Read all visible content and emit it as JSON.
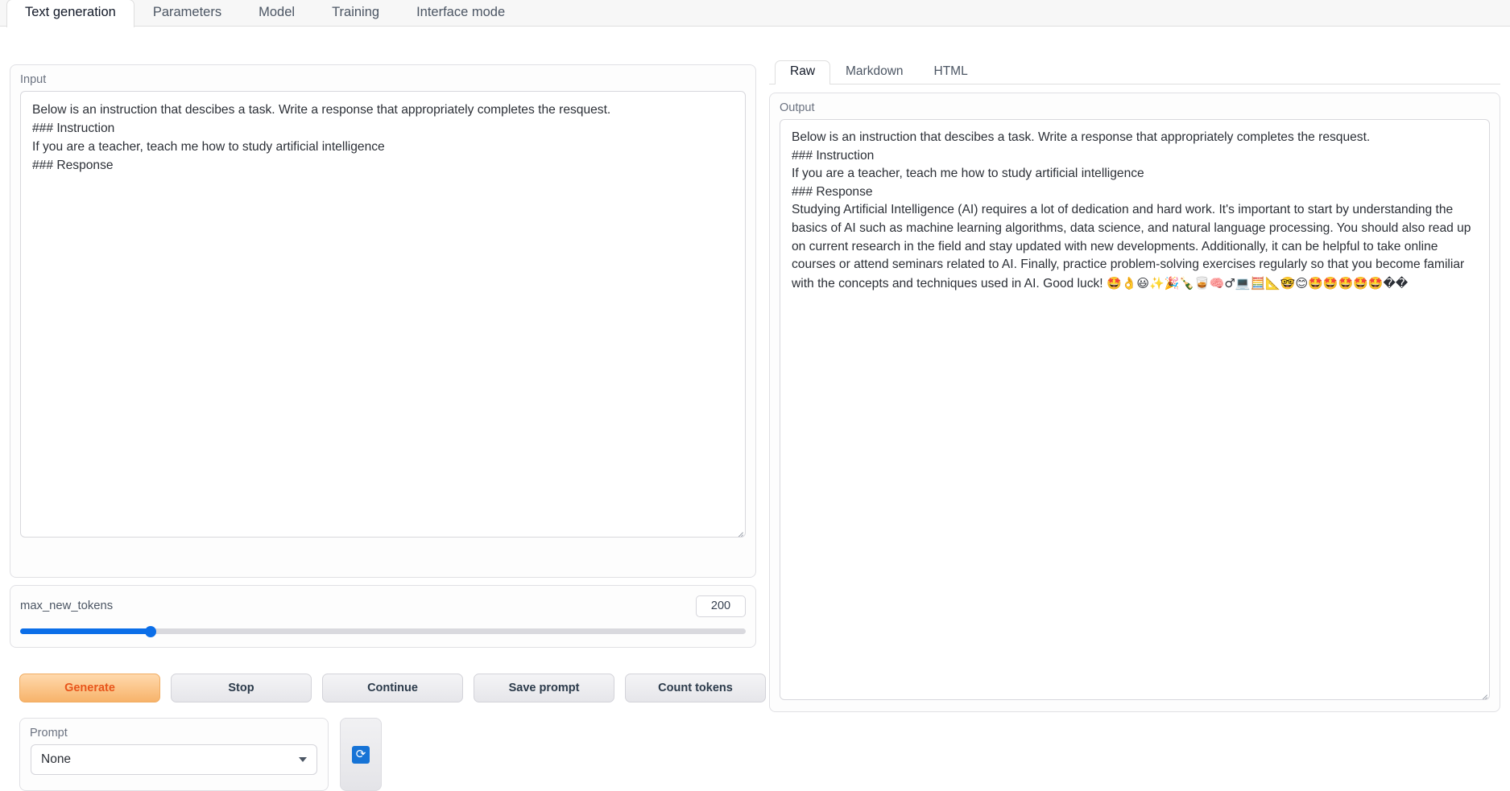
{
  "top_tabs": [
    {
      "label": "Text generation",
      "active": true
    },
    {
      "label": "Parameters",
      "active": false
    },
    {
      "label": "Model",
      "active": false
    },
    {
      "label": "Training",
      "active": false
    },
    {
      "label": "Interface mode",
      "active": false
    }
  ],
  "input": {
    "label": "Input",
    "value": "Below is an instruction that descibes a task. Write a response that appropriately completes the resquest.\n### Instruction\nIf you are a teacher, teach me how to study artificial intelligence\n### Response"
  },
  "slider": {
    "name": "max_new_tokens",
    "value": "200",
    "fill_percent": 18
  },
  "buttons": [
    {
      "label": "Generate",
      "primary": true
    },
    {
      "label": "Stop",
      "primary": false
    },
    {
      "label": "Continue",
      "primary": false
    },
    {
      "label": "Save prompt",
      "primary": false
    },
    {
      "label": "Count tokens",
      "primary": false
    }
  ],
  "prompt": {
    "label": "Prompt",
    "selected": "None",
    "refresh_icon": "refresh-icon"
  },
  "output_tabs": [
    {
      "label": "Raw",
      "active": true
    },
    {
      "label": "Markdown",
      "active": false
    },
    {
      "label": "HTML",
      "active": false
    }
  ],
  "output": {
    "label": "Output",
    "line1": "Below is an instruction that descibes a task. Write a response that appropriately completes the resquest.",
    "line2": "### Instruction",
    "line3": "If you are a teacher, teach me how to study artificial intelligence",
    "line4": "### Response",
    "body": "Studying Artificial Intelligence (AI) requires a lot of dedication and hard work. It's important to start by understanding the basics of AI such as machine learning algorithms, data science, and natural language processing. You should also read up on current research in the field and stay updated with new developments. Additionally, it can be helpful to take online courses or attend seminars related to AI. Finally, practice problem-solving exercises regularly so that you become familiar with the concepts and techniques used in AI. Good luck! ",
    "emojis": "🤩👌😃✨🎉🍾🥃🧠♂💻🧮📐🤓😊🤩🤩🤩🤩",
    "emojis_tail": "🤩��"
  },
  "colors": {
    "accent_blue": "#0b6ee8",
    "generate_orange": "#f7b36a",
    "generate_text": "#e8541a",
    "panel_border": "#e0e0e4"
  }
}
